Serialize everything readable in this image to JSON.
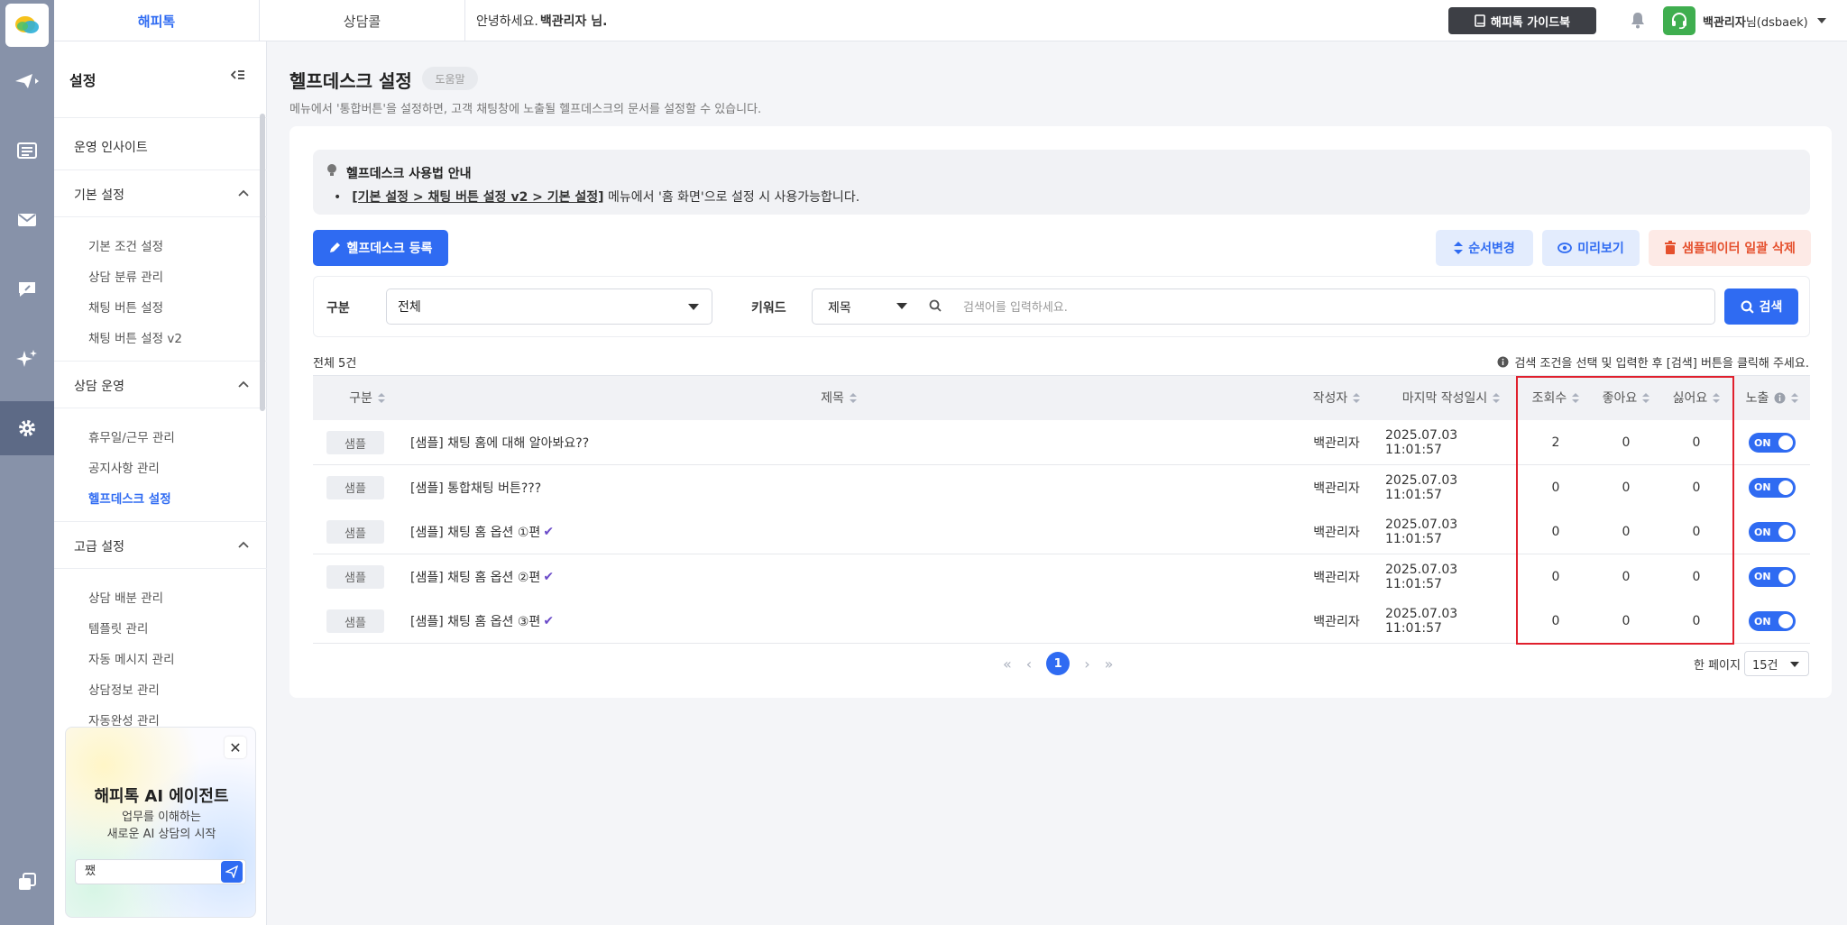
{
  "topbar": {
    "tabs": [
      {
        "label": "해피톡"
      },
      {
        "label": "상담콜"
      }
    ],
    "greeting_prefix": "안녕하세요.",
    "greeting_name": "백관리자 님.",
    "guide_label": "해피톡 가이드북",
    "user_name": "백관리자",
    "user_id": "님(dsbaek)"
  },
  "sidebar": {
    "title": "설정",
    "top_item": "운영 인사이트",
    "sections": [
      {
        "label": "기본 설정",
        "items": [
          "기본 조건 설정",
          "상담 분류 관리",
          "채팅 버튼 설정",
          "채팅 버튼 설정 v2"
        ]
      },
      {
        "label": "상담 운영",
        "items": [
          "휴무일/근무 관리",
          "공지사항 관리",
          "헬프데스크 설정"
        ]
      },
      {
        "label": "고급 설정",
        "items": [
          "상담 배분 관리",
          "템플릿 관리",
          "자동 메시지 관리",
          "상담정보 관리",
          "자동완성 관리"
        ]
      }
    ],
    "active_item": "헬프데스크 설정"
  },
  "ai_card": {
    "title": "해피톡 AI 에이전트",
    "subtitle_1": "업무를 이해하는",
    "subtitle_2": "새로운 AI 상담의 시작",
    "input_value": "쨌",
    "close": "✕"
  },
  "page": {
    "title": "헬프데스크 설정",
    "help_badge": "도움말",
    "description": "메뉴에서 '통합버튼'을 설정하면, 고객 채팅창에 노출될 헬프데스크의 문서를 설정할 수 있습니다."
  },
  "notice": {
    "title": "헬프데스크 사용법 안내",
    "link": "[기본 설정 > 채팅 버튼 설정 v2 > 기본 설정]",
    "text": " 메뉴에서 '홈 화면'으로 설정 시 사용가능합니다."
  },
  "actions": {
    "register": "헬프데스크 등록",
    "order": "순서변경",
    "preview": "미리보기",
    "delete_samples": "샘플데이터 일괄 삭제"
  },
  "filter": {
    "category_label": "구분",
    "category_value": "전체",
    "keyword_label": "키워드",
    "keyword_field": "제목",
    "search_placeholder": "검색어를 입력하세요.",
    "search_button": "검색"
  },
  "list": {
    "total": "전체 5건",
    "hint": "검색 조건을 선택 및 입력한 후 [검색] 버튼을 클릭해 주세요.",
    "columns": [
      "구분",
      "제목",
      "작성자",
      "마지막 작성일시",
      "조회수",
      "좋아요",
      "싫어요",
      "노출"
    ],
    "rows": [
      {
        "category": "샘플",
        "title": "[샘플] 채팅 홈에 대해 알아봐요??",
        "check": "",
        "author": "백관리자",
        "date": "2025.07.03 11:01:57",
        "views": "2",
        "likes": "0",
        "dislikes": "0",
        "visible": "ON"
      },
      {
        "category": "샘플",
        "title": "[샘플] 통합채팅 버튼???",
        "check": "",
        "author": "백관리자",
        "date": "2025.07.03 11:01:57",
        "views": "0",
        "likes": "0",
        "dislikes": "0",
        "visible": "ON"
      },
      {
        "category": "샘플",
        "title": "[샘플] 채팅 홈 옵션 ①편",
        "check": "✔",
        "author": "백관리자",
        "date": "2025.07.03 11:01:57",
        "views": "0",
        "likes": "0",
        "dislikes": "0",
        "visible": "ON"
      },
      {
        "category": "샘플",
        "title": "[샘플] 채팅 홈 옵션 ②편",
        "check": "✔",
        "author": "백관리자",
        "date": "2025.07.03 11:01:57",
        "views": "0",
        "likes": "0",
        "dislikes": "0",
        "visible": "ON"
      },
      {
        "category": "샘플",
        "title": "[샘플] 채팅 홈 옵션 ③편",
        "check": "✔",
        "author": "백관리자",
        "date": "2025.07.03 11:01:57",
        "views": "0",
        "likes": "0",
        "dislikes": "0",
        "visible": "ON"
      }
    ]
  },
  "pagination": {
    "first": "«",
    "prev": "‹",
    "current": "1",
    "next": "›",
    "last": "»",
    "per_page_label": "한 페이지",
    "per_page_value": "15건"
  },
  "colors": {
    "accent": "#2f6bf2",
    "danger": "#e5502d",
    "highlight_box": "#e0202d",
    "rail": "#8792a9"
  }
}
